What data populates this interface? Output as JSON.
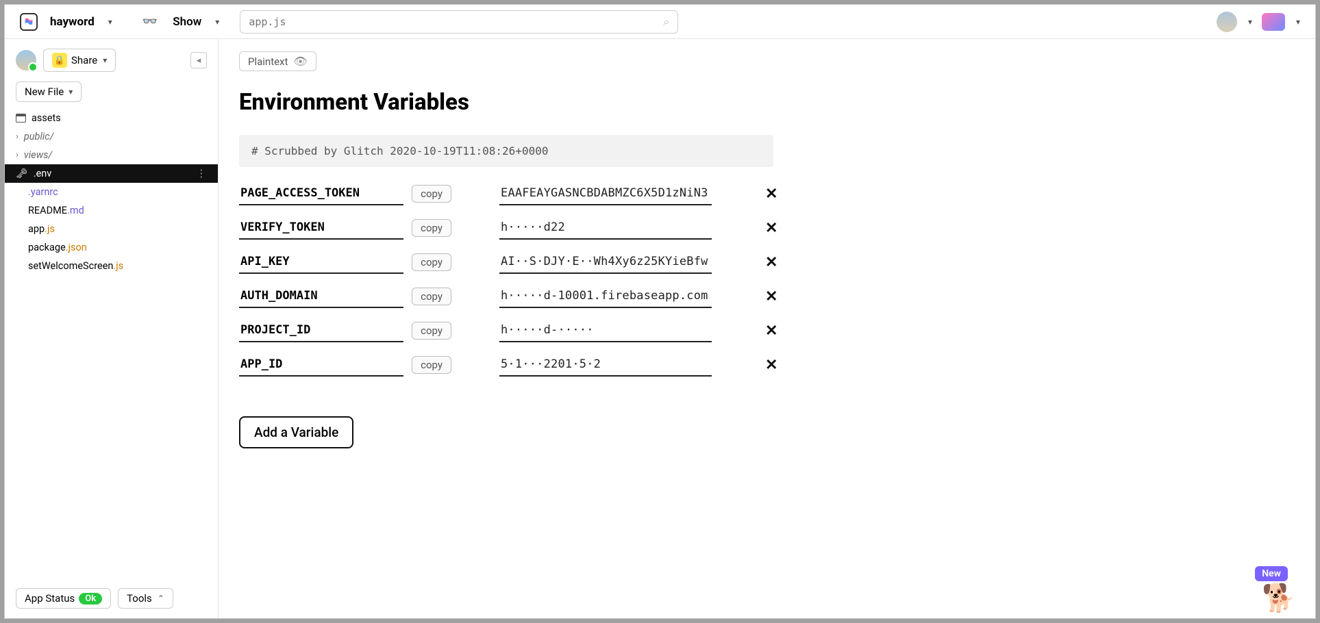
{
  "header": {
    "project_name": "hayword",
    "show_label": "Show",
    "search_placeholder": "app.js"
  },
  "sidebar": {
    "share_label": "Share",
    "new_file_label": "New File",
    "files": {
      "assets": "assets",
      "public": "public/",
      "views": "views/",
      "env": ".env",
      "yarnrc": ".yarnrc",
      "readme_base": "README",
      "readme_ext": ".md",
      "app_base": "app",
      "app_ext": ".js",
      "pkg_base": "package",
      "pkg_ext": ".json",
      "welcome_base": "setWelcomeScreen",
      "welcome_ext": ".js"
    },
    "status_label": "App Status",
    "status_badge": "Ok",
    "tools_label": "Tools"
  },
  "content": {
    "plaintext_label": "Plaintext",
    "page_title": "Environment Variables",
    "scrubbed_text": "# Scrubbed by Glitch 2020-10-19T11:08:26+0000",
    "copy_label": "copy",
    "vars": [
      {
        "name": "PAGE_ACCESS_TOKEN",
        "value": "EAAFEAYGASNCBDABMZC6X5D1zNiN3"
      },
      {
        "name": "VERIFY_TOKEN",
        "value": "h·····d22"
      },
      {
        "name": "API_KEY",
        "value": "AI··S·DJY·E··Wh4Xy6z25KYieBfw"
      },
      {
        "name": "AUTH_DOMAIN",
        "value": "h·····d-10001.firebaseapp.com"
      },
      {
        "name": "PROJECT_ID",
        "value": "h·····d-·····"
      },
      {
        "name": "APP_ID",
        "value": "5·1···2201·5·2"
      }
    ],
    "add_var_label": "Add a Variable"
  },
  "footer": {
    "new_badge": "New"
  }
}
